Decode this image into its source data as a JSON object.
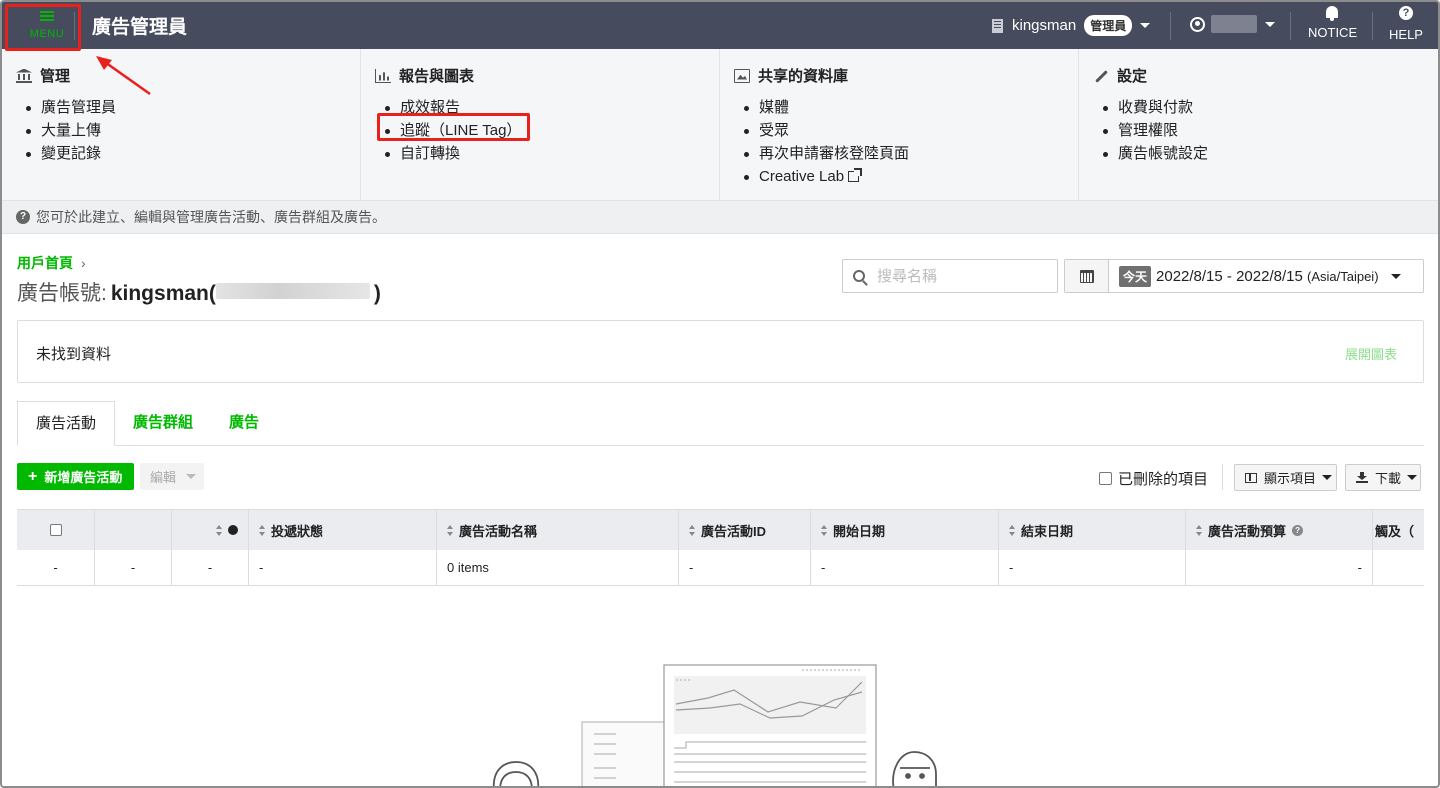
{
  "header": {
    "menu_label": "MENU",
    "app_title": "廣告管理員",
    "account_name": "kingsman",
    "role_badge": "管理員",
    "notice_label": "NOTICE",
    "help_label": "HELP"
  },
  "mega_menu": [
    {
      "icon": "bank-icon",
      "title": "管理",
      "items": [
        "廣告管理員",
        "大量上傳",
        "變更記錄"
      ]
    },
    {
      "icon": "bar-chart-icon",
      "title": "報告與圖表",
      "items": [
        "成效報告",
        "追蹤（LINE Tag）",
        "自訂轉換"
      ]
    },
    {
      "icon": "image-icon",
      "title": "共享的資料庫",
      "items": [
        "媒體",
        "受眾",
        "再次申請審核登陸頁面",
        "Creative Lab"
      ]
    },
    {
      "icon": "wrench-icon",
      "title": "設定",
      "items": [
        "收費與付款",
        "管理權限",
        "廣告帳號設定"
      ]
    }
  ],
  "info_text": "您可於此建立、編輯與管理廣告活動、廣告群組及廣告。",
  "breadcrumb": {
    "home": "用戶首頁",
    "separator": "›"
  },
  "account_title": {
    "prefix": "廣告帳號:",
    "name": "kingsman(",
    "suffix": ")"
  },
  "search": {
    "placeholder": "搜尋名稱"
  },
  "date_range": {
    "today_badge": "今天",
    "start": "2022/8/15",
    "dash": " - ",
    "end": "2022/8/15",
    "timezone": "(Asia/Taipei)"
  },
  "chart_panel": {
    "empty_message": "未找到資料",
    "expand_label": "展開圖表"
  },
  "tabs": [
    {
      "label": "廣告活動",
      "active": true
    },
    {
      "label": "廣告群組",
      "active": false
    },
    {
      "label": "廣告",
      "active": false
    }
  ],
  "toolbar": {
    "new_label": "新增廣告活動",
    "edit_label": "編輯",
    "show_deleted_label": "已刪除的項目",
    "columns_label": "顯示項目",
    "download_label": "下載"
  },
  "table": {
    "headers": [
      "",
      "",
      "",
      "投遞狀態",
      "廣告活動名稱",
      "廣告活動ID",
      "開始日期",
      "結束日期",
      "廣告活動預算",
      "觸及（"
    ],
    "row": [
      "-",
      "-",
      "-",
      "-",
      "0 items",
      "-",
      "-",
      "-",
      "-",
      ""
    ]
  },
  "colors": {
    "brand_green": "#00b900",
    "topbar": "#464b5e",
    "highlight_red": "#e8211d"
  }
}
